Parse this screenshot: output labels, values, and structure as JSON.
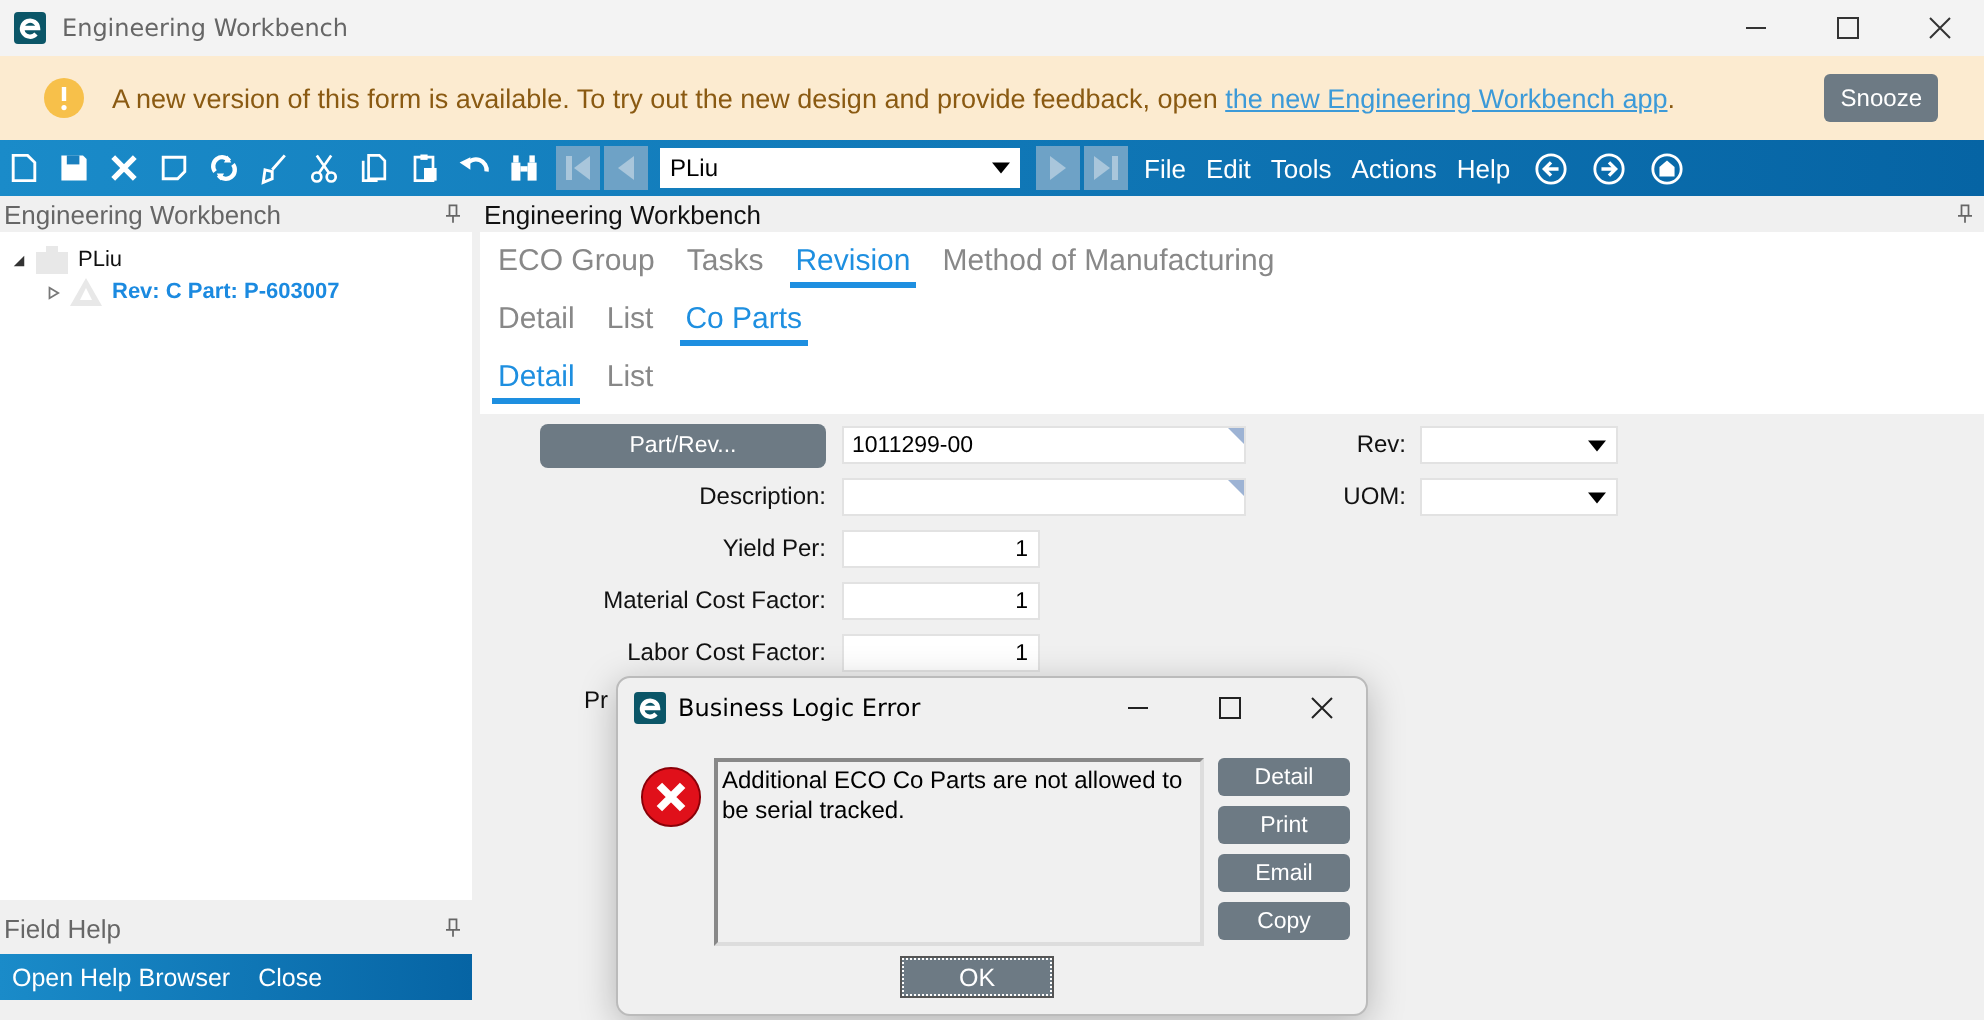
{
  "window": {
    "title": "Engineering Workbench"
  },
  "banner": {
    "text": "A new version of this form is available. To try out the new design and provide feedback, open ",
    "link": "the new Engineering Workbench app",
    "after": ".",
    "button": "Snooze"
  },
  "toolbar": {
    "combo_value": "PLiu",
    "menus": [
      "File",
      "Edit",
      "Tools",
      "Actions",
      "Help"
    ]
  },
  "left_panel": {
    "title": "Engineering Workbench",
    "tree": [
      {
        "label": "PLiu",
        "expanded": true,
        "children": [
          {
            "label": "Rev: C Part: P-603007",
            "expanded": false
          }
        ]
      }
    ]
  },
  "field_help": {
    "title": "Field Help",
    "actions": [
      "Open Help Browser",
      "Close"
    ]
  },
  "main": {
    "title": "Engineering Workbench",
    "tabs": [
      [
        {
          "label": "ECO Group",
          "selected": false
        },
        {
          "label": "Tasks",
          "selected": false
        },
        {
          "label": "Revision",
          "selected": true
        },
        {
          "label": "Method of Manufacturing",
          "selected": false
        }
      ],
      [
        {
          "label": "Detail",
          "selected": false
        },
        {
          "label": "List",
          "selected": false
        },
        {
          "label": "Co Parts",
          "selected": true
        }
      ],
      [
        {
          "label": "Detail",
          "selected": true
        },
        {
          "label": "List",
          "selected": false
        }
      ]
    ],
    "form": {
      "part_button": "Part/Rev...",
      "fields": [
        {
          "kind": "lookup",
          "value": "1011299-00"
        },
        {
          "kind": "lookup",
          "label": "Description:"
        },
        {
          "kind": "number",
          "label": "Yield Per:",
          "value": "1"
        },
        {
          "kind": "number",
          "label": "Material Cost Factor:",
          "value": "1"
        },
        {
          "kind": "number",
          "label": "Labor Cost Factor:",
          "value": "1"
        },
        {
          "kind": "cut",
          "label": "Pr"
        }
      ],
      "side_fields": [
        {
          "label": "Rev:"
        },
        {
          "label": "UOM:"
        }
      ]
    }
  },
  "dialog": {
    "title": "Business Logic Error",
    "message": "Additional ECO Co Parts are not allowed to be serial tracked.",
    "buttons": [
      "Detail",
      "Print",
      "Email",
      "Copy"
    ],
    "ok": "OK"
  }
}
